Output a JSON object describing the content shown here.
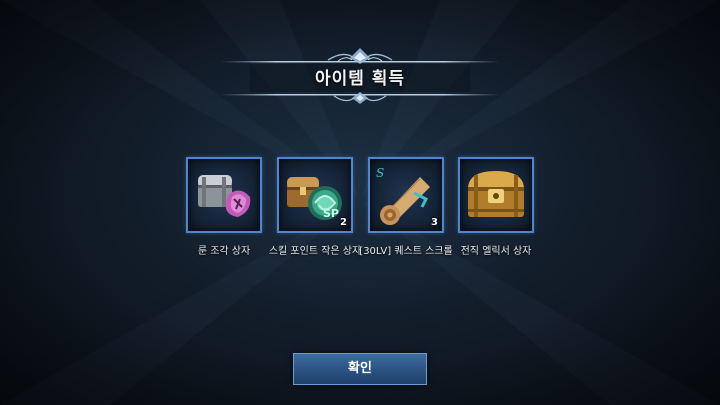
{
  "dialog": {
    "title": "아이템 획득",
    "confirm_label": "확인"
  },
  "items": [
    {
      "name": "룬 조각 상자",
      "count": "",
      "icon": "silver-chest-rune-icon"
    },
    {
      "name": "스킬 포인트 작은 상자",
      "count": "2",
      "icon": "skill-point-chest-icon"
    },
    {
      "name": "[30LV] 퀘스트 스크롤",
      "count": "3",
      "icon": "quest-scroll-icon"
    },
    {
      "name": "전직 엘릭서 상자",
      "count": "",
      "icon": "gold-chest-icon"
    }
  ],
  "colors": {
    "slot_border": "#4f86d0",
    "button": "#2c5484",
    "background": "#121d2a"
  }
}
